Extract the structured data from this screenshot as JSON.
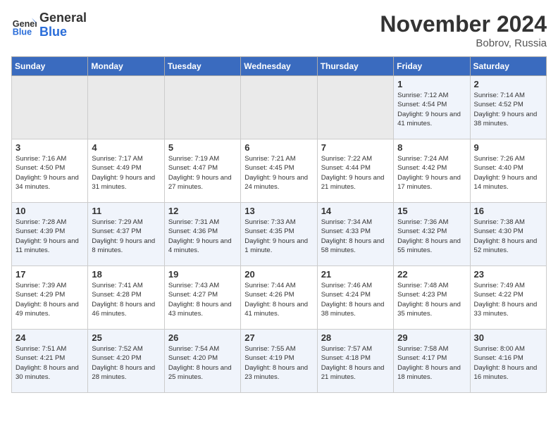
{
  "logo": {
    "general": "General",
    "blue": "Blue"
  },
  "title": "November 2024",
  "location": "Bobrov, Russia",
  "weekdays": [
    "Sunday",
    "Monday",
    "Tuesday",
    "Wednesday",
    "Thursday",
    "Friday",
    "Saturday"
  ],
  "weeks": [
    [
      {
        "day": "",
        "info": ""
      },
      {
        "day": "",
        "info": ""
      },
      {
        "day": "",
        "info": ""
      },
      {
        "day": "",
        "info": ""
      },
      {
        "day": "",
        "info": ""
      },
      {
        "day": "1",
        "info": "Sunrise: 7:12 AM\nSunset: 4:54 PM\nDaylight: 9 hours and 41 minutes."
      },
      {
        "day": "2",
        "info": "Sunrise: 7:14 AM\nSunset: 4:52 PM\nDaylight: 9 hours and 38 minutes."
      }
    ],
    [
      {
        "day": "3",
        "info": "Sunrise: 7:16 AM\nSunset: 4:50 PM\nDaylight: 9 hours and 34 minutes."
      },
      {
        "day": "4",
        "info": "Sunrise: 7:17 AM\nSunset: 4:49 PM\nDaylight: 9 hours and 31 minutes."
      },
      {
        "day": "5",
        "info": "Sunrise: 7:19 AM\nSunset: 4:47 PM\nDaylight: 9 hours and 27 minutes."
      },
      {
        "day": "6",
        "info": "Sunrise: 7:21 AM\nSunset: 4:45 PM\nDaylight: 9 hours and 24 minutes."
      },
      {
        "day": "7",
        "info": "Sunrise: 7:22 AM\nSunset: 4:44 PM\nDaylight: 9 hours and 21 minutes."
      },
      {
        "day": "8",
        "info": "Sunrise: 7:24 AM\nSunset: 4:42 PM\nDaylight: 9 hours and 17 minutes."
      },
      {
        "day": "9",
        "info": "Sunrise: 7:26 AM\nSunset: 4:40 PM\nDaylight: 9 hours and 14 minutes."
      }
    ],
    [
      {
        "day": "10",
        "info": "Sunrise: 7:28 AM\nSunset: 4:39 PM\nDaylight: 9 hours and 11 minutes."
      },
      {
        "day": "11",
        "info": "Sunrise: 7:29 AM\nSunset: 4:37 PM\nDaylight: 9 hours and 8 minutes."
      },
      {
        "day": "12",
        "info": "Sunrise: 7:31 AM\nSunset: 4:36 PM\nDaylight: 9 hours and 4 minutes."
      },
      {
        "day": "13",
        "info": "Sunrise: 7:33 AM\nSunset: 4:35 PM\nDaylight: 9 hours and 1 minute."
      },
      {
        "day": "14",
        "info": "Sunrise: 7:34 AM\nSunset: 4:33 PM\nDaylight: 8 hours and 58 minutes."
      },
      {
        "day": "15",
        "info": "Sunrise: 7:36 AM\nSunset: 4:32 PM\nDaylight: 8 hours and 55 minutes."
      },
      {
        "day": "16",
        "info": "Sunrise: 7:38 AM\nSunset: 4:30 PM\nDaylight: 8 hours and 52 minutes."
      }
    ],
    [
      {
        "day": "17",
        "info": "Sunrise: 7:39 AM\nSunset: 4:29 PM\nDaylight: 8 hours and 49 minutes."
      },
      {
        "day": "18",
        "info": "Sunrise: 7:41 AM\nSunset: 4:28 PM\nDaylight: 8 hours and 46 minutes."
      },
      {
        "day": "19",
        "info": "Sunrise: 7:43 AM\nSunset: 4:27 PM\nDaylight: 8 hours and 43 minutes."
      },
      {
        "day": "20",
        "info": "Sunrise: 7:44 AM\nSunset: 4:26 PM\nDaylight: 8 hours and 41 minutes."
      },
      {
        "day": "21",
        "info": "Sunrise: 7:46 AM\nSunset: 4:24 PM\nDaylight: 8 hours and 38 minutes."
      },
      {
        "day": "22",
        "info": "Sunrise: 7:48 AM\nSunset: 4:23 PM\nDaylight: 8 hours and 35 minutes."
      },
      {
        "day": "23",
        "info": "Sunrise: 7:49 AM\nSunset: 4:22 PM\nDaylight: 8 hours and 33 minutes."
      }
    ],
    [
      {
        "day": "24",
        "info": "Sunrise: 7:51 AM\nSunset: 4:21 PM\nDaylight: 8 hours and 30 minutes."
      },
      {
        "day": "25",
        "info": "Sunrise: 7:52 AM\nSunset: 4:20 PM\nDaylight: 8 hours and 28 minutes."
      },
      {
        "day": "26",
        "info": "Sunrise: 7:54 AM\nSunset: 4:20 PM\nDaylight: 8 hours and 25 minutes."
      },
      {
        "day": "27",
        "info": "Sunrise: 7:55 AM\nSunset: 4:19 PM\nDaylight: 8 hours and 23 minutes."
      },
      {
        "day": "28",
        "info": "Sunrise: 7:57 AM\nSunset: 4:18 PM\nDaylight: 8 hours and 21 minutes."
      },
      {
        "day": "29",
        "info": "Sunrise: 7:58 AM\nSunset: 4:17 PM\nDaylight: 8 hours and 18 minutes."
      },
      {
        "day": "30",
        "info": "Sunrise: 8:00 AM\nSunset: 4:16 PM\nDaylight: 8 hours and 16 minutes."
      }
    ]
  ]
}
